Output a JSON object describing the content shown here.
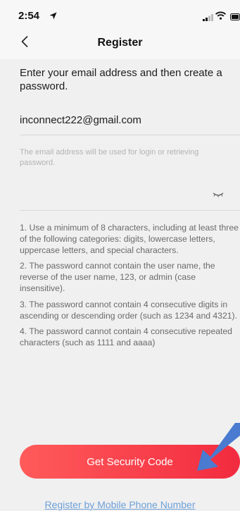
{
  "status_bar": {
    "time": "2:54",
    "icons": [
      "location-arrow-icon",
      "signal-icon",
      "wifi-icon",
      "battery-icon"
    ]
  },
  "nav": {
    "title": "Register",
    "back_icon": "chevron-left-icon"
  },
  "form": {
    "instruction": "Enter your email address and then create a password.",
    "email_value": "inconnect222@gmail.com",
    "email_hint": "The email address will be used for login or retrieving password.",
    "password_value": "",
    "password_toggle_icon": "eye-closed-icon"
  },
  "rules": [
    "1. Use a minimum of 8 characters, including at least three of the following categories: digits, lowercase letters, uppercase letters, and special characters.",
    "2. The password cannot contain the user name, the reverse of the user name, 123, or admin (case insensitive).",
    "3. The password cannot contain 4 consecutive digits in ascending or descending order (such as 1234 and 4321).",
    "4. The password cannot contain 4 consecutive repeated characters (such as 1111 and aaaa)"
  ],
  "actions": {
    "primary_label": "Get Security Code",
    "secondary_label": "Register by Mobile Phone Number"
  },
  "colors": {
    "primary_start": "#ff5b5b",
    "primary_end": "#f22b3f",
    "link": "#6c9fd8",
    "annotation_arrow": "#4a7bd0"
  }
}
